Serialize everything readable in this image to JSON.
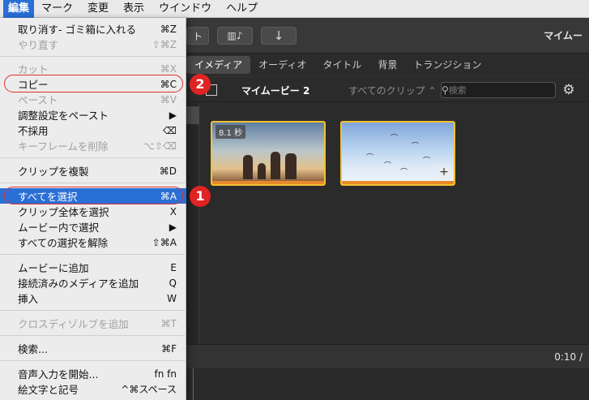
{
  "menubar": {
    "items": [
      "編集",
      "マーク",
      "変更",
      "表示",
      "ウインドウ",
      "ヘルプ"
    ]
  },
  "toolbar": {
    "partial_label": "ト",
    "media_icon_glyph": "▥♪",
    "import_icon_glyph": "↓",
    "title": "マイムー"
  },
  "tabs": [
    "イメディア",
    "オーディオ",
    "タイトル",
    "背景",
    "トランジション"
  ],
  "subbar": {
    "title": "マイムービー 2",
    "clips_filter": "すべてのクリップ ⌃",
    "search_placeholder": "検索",
    "gear_glyph": "⚙"
  },
  "clips": {
    "first_duration": "8.1 秒",
    "add_glyph": "+"
  },
  "timeline": {
    "time": "0:10 /"
  },
  "edit_menu": {
    "items": [
      {
        "label": "取り消す- ゴミ箱に入れる",
        "shortcut": "⌘Z",
        "disabled": false
      },
      {
        "label": "やり直す",
        "shortcut": "⇧⌘Z",
        "disabled": true
      },
      {
        "label": "カット",
        "shortcut": "⌘X",
        "disabled": true
      },
      {
        "label": "コピー",
        "shortcut": "⌘C",
        "disabled": false
      },
      {
        "label": "ペースト",
        "shortcut": "⌘V",
        "disabled": true
      },
      {
        "label": "調整設定をペースト",
        "shortcut": "▶",
        "disabled": false
      },
      {
        "label": "不採用",
        "shortcut": "⌫",
        "disabled": false
      },
      {
        "label": "キーフレームを削除",
        "shortcut": "⌥⇧⌫",
        "disabled": true
      },
      {
        "label": "クリップを複製",
        "shortcut": "⌘D",
        "disabled": false
      },
      {
        "label": "すべてを選択",
        "shortcut": "⌘A",
        "disabled": false,
        "highlighted": true
      },
      {
        "label": "クリップ全体を選択",
        "shortcut": "X",
        "disabled": false
      },
      {
        "label": "ムービー内で選択",
        "shortcut": "▶",
        "disabled": false
      },
      {
        "label": "すべての選択を解除",
        "shortcut": "⇧⌘A",
        "disabled": false
      },
      {
        "label": "ムービーに追加",
        "shortcut": "E",
        "disabled": false
      },
      {
        "label": "接続済みのメディアを追加",
        "shortcut": "Q",
        "disabled": false
      },
      {
        "label": "挿入",
        "shortcut": "W",
        "disabled": false
      },
      {
        "label": "クロスディゾルブを追加",
        "shortcut": "⌘T",
        "disabled": true
      },
      {
        "label": "検索...",
        "shortcut": "⌘F",
        "disabled": false
      },
      {
        "label": "音声入力を開始...",
        "shortcut": "fn fn",
        "disabled": false
      },
      {
        "label": "絵文字と記号",
        "shortcut": "^⌘スペース",
        "disabled": false
      }
    ]
  },
  "annotations": {
    "step1": "1",
    "step2": "2",
    "highlight_color": "#2a6fd6",
    "marker_color": "#e02323"
  }
}
